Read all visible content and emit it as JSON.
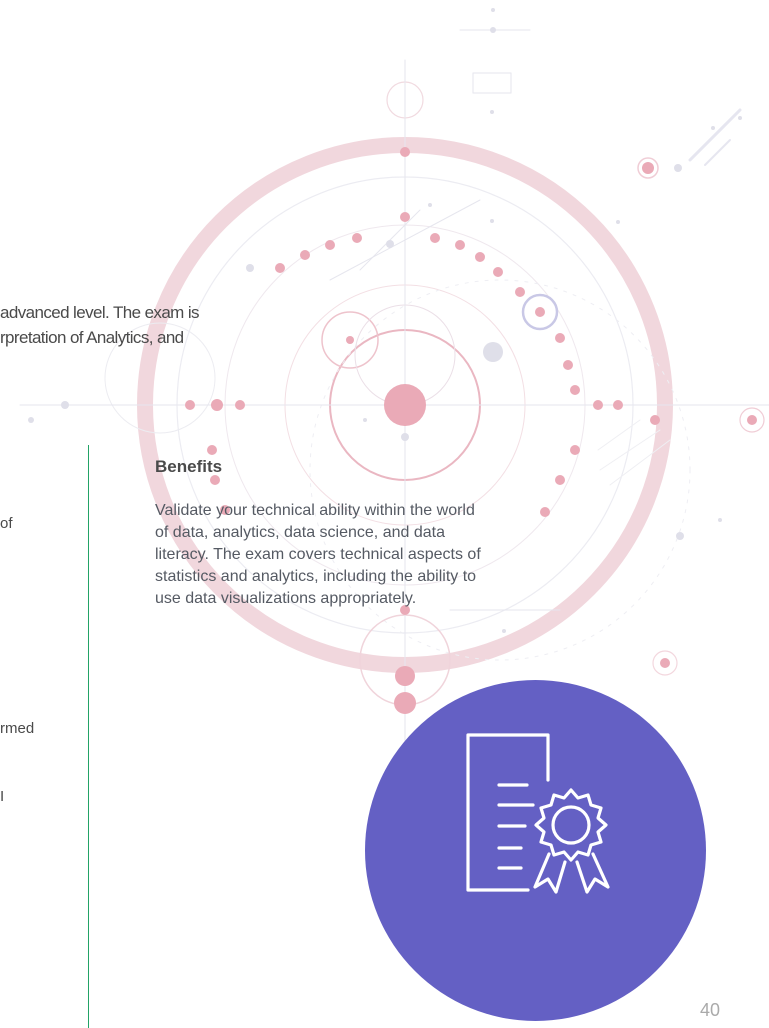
{
  "intro": {
    "line1": "advanced level. The exam is",
    "line2": "rpretation of Analytics, and"
  },
  "left_column": {
    "frag1": "of",
    "frag2": "rmed",
    "frag3": "I"
  },
  "benefits": {
    "title": "Benefits",
    "lines": [
      "Validate your technical ability within the world",
      "of data, analytics, data science, and data",
      "literacy. The exam covers technical aspects of",
      "statistics and analytics, including the ability to",
      "use data visualizations appropriately."
    ]
  },
  "badge": {
    "icon": "certificate-icon",
    "circle_color": "#6460c4"
  },
  "page_number": "40",
  "colors": {
    "decor_pink": "#f2c6cf",
    "decor_pink_dot": "#e89aa9",
    "decor_gray": "#dcdce6",
    "divider": "#22a366"
  }
}
